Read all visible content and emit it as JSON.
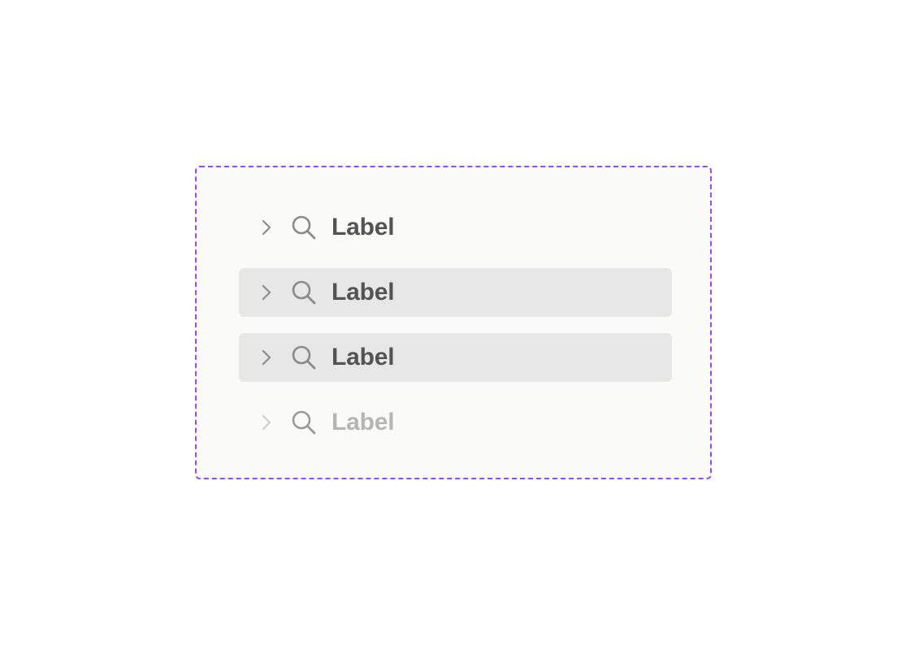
{
  "tree": {
    "items": [
      {
        "label": "Label",
        "state": "default"
      },
      {
        "label": "Label",
        "state": "hover"
      },
      {
        "label": "Label",
        "state": "selected"
      },
      {
        "label": "Label",
        "state": "disabled"
      }
    ]
  },
  "colors": {
    "frame_border": "#9747ff",
    "frame_bg": "#fafaf9",
    "highlight_bg": "#e7e7e7",
    "text": "#545454",
    "text_disabled": "#b5b5b5",
    "icon": "#8a8a8a",
    "icon_disabled": "#cfcfcf"
  },
  "icons": {
    "expand": "chevron-right-icon",
    "leading": "search-icon"
  }
}
